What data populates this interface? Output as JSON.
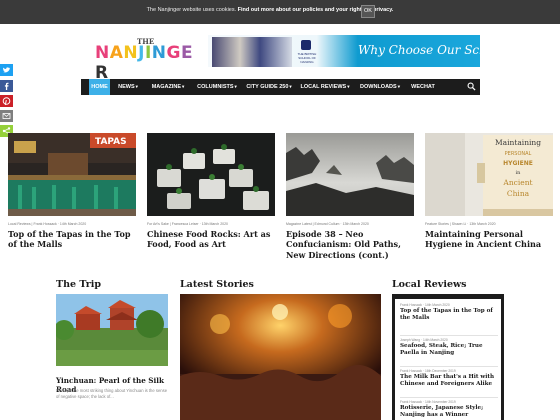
{
  "cookie_bar": {
    "text": "The Nanjinger website uses cookies.",
    "link": "Find out more about our policies and your rights to privacy.",
    "ok_label": "OK"
  },
  "header": {
    "logo_the": "THE",
    "logo_letters": [
      "N",
      "A",
      "N",
      "J",
      "I",
      "N",
      "G",
      "E",
      "R"
    ],
    "logo_colors": [
      "#e8407a",
      "#f7a21b",
      "#f3c21d",
      "#44b8e8",
      "#8dc63f",
      "#2f9bd6",
      "#e8407a",
      "#9b5aa6",
      "#333333"
    ],
    "banner_tagline": "Why Choose Our School?",
    "banner_school": "THE BRITISH SCHOOL OF NANJING"
  },
  "nav": {
    "items": [
      "HOME",
      "NEWS",
      "MAGAZINE",
      "COLUMNISTS",
      "CITY GUIDE 250",
      "LOCAL REVIEWS",
      "DOWNLOADS",
      "WECHAT"
    ],
    "dropdown": [
      false,
      true,
      true,
      true,
      true,
      true,
      true,
      false
    ],
    "active_color": "#3db0e8"
  },
  "share_bar": {
    "icons": [
      "twitter-icon",
      "facebook-icon",
      "pinterest-icon",
      "email-icon",
      "sharethis-icon"
    ],
    "colors": [
      "#1da1f2",
      "#3b5998",
      "#cb2027",
      "#7f7f7f",
      "#95d03a"
    ]
  },
  "featured": [
    {
      "category": "Local Reviews",
      "author": "Frank Hossack",
      "date": "14th March 2020",
      "title": "Top of the Tapas in the Top of the Malls",
      "image_label": "TAPAS"
    },
    {
      "category": "For Art's Sake",
      "author": "Francesca Leiser",
      "date": "13th March 2020",
      "title": "Chinese Food Rocks: Art as Food, Food as Art"
    },
    {
      "category": "Magazine Latest",
      "author": "Edmund Cullum",
      "date": "13th March 2020",
      "title": "Episode 38 – Neo Confucianism: Old Paths, New Directions (cont.)"
    },
    {
      "category": "Feature Stories",
      "author": "Shawn Li",
      "date": "13th March 2020",
      "title": "Maintaining Personal Hygiene in Ancient China",
      "image_lines": [
        "Maintaining",
        "PERSONAL",
        "HYGIENE",
        "in",
        "Ancient",
        "China"
      ]
    }
  ],
  "sections": {
    "trip": "The Trip",
    "latest": "Latest Stories",
    "reviews": "Local Reviews"
  },
  "trip": {
    "title": "Yinchuan: Pearl of the Silk Road",
    "description": "Perhaps the most striking thing about Yinchuan is the sense of negative space; the lack of..."
  },
  "reviews": [
    {
      "author": "Frank Hossack",
      "date": "14th March 2020",
      "title": "Top of the Tapas in the Top of the Malls"
    },
    {
      "author": "Joseph Wang",
      "date": "14th March 2020",
      "title": "Seafood, Steak, Rice; True Paella in Nanjing"
    },
    {
      "author": "Frank Hossack",
      "date": "16th December 2019",
      "title": "The Milk Bar that's a Hit with Chinese and Foreigners Alike"
    },
    {
      "author": "Frank Hossack",
      "date": "14th November 2019",
      "title": "Rotisserie, Japanese Style; Nanjing has a Winner"
    }
  ]
}
